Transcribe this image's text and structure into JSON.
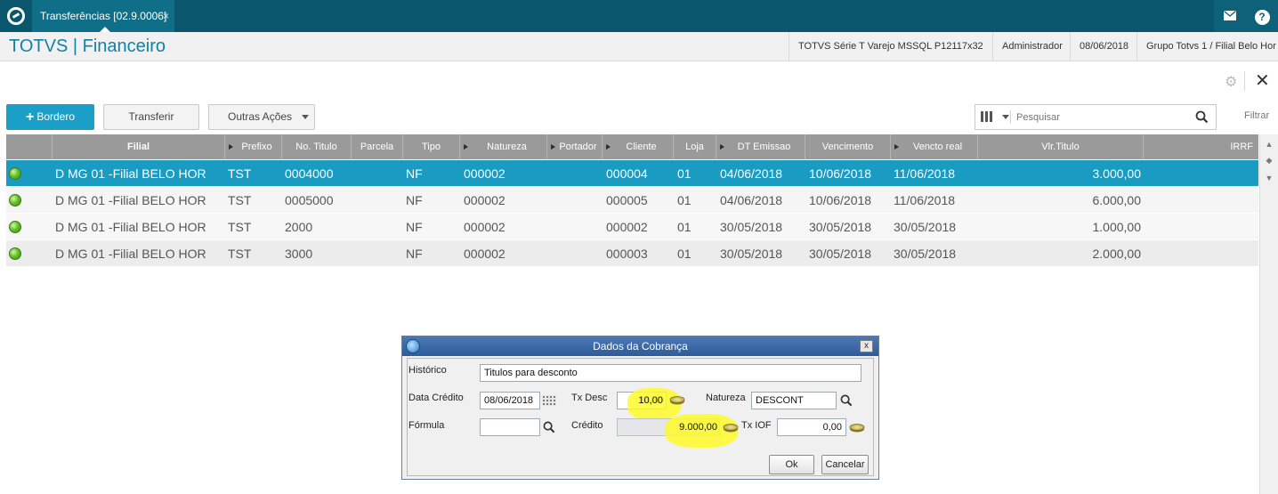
{
  "topbar": {
    "tab_label": "Transferências [02.9.0006]",
    "tab_close": "×",
    "mail_icon": "envelope-icon",
    "help_label": "?"
  },
  "header": {
    "app_title": "TOTVS | Financeiro",
    "environment": "TOTVS Série T Varejo MSSQL P12117x32",
    "user": "Administrador",
    "date": "08/06/2018",
    "branch": "Grupo Totvs 1 / Filial Belo Hor"
  },
  "toolbar": {
    "bordero_label": "Bordero",
    "transferir_label": "Transferir",
    "outras_label": "Outras Ações",
    "search_placeholder": "Pesquisar",
    "filtrar_label": "Filtrar",
    "close_label": "✕"
  },
  "grid": {
    "columns": [
      "",
      "Filial",
      "Prefixo",
      "No. Titulo",
      "Parcela",
      "Tipo",
      "Natureza",
      "Portador",
      "Cliente",
      "Loja",
      "DT Emissao",
      "Vencimento",
      "Vencto real",
      "Vlr.Titulo",
      "IRRF"
    ],
    "rows": [
      {
        "filial": "D MG 01 -Filial BELO HOR",
        "prefixo": "TST",
        "numero": "0004000",
        "parcela": "",
        "tipo": "NF",
        "natureza": "000002",
        "portador": "",
        "cliente": "000004",
        "loja": "01",
        "emissao": "04/06/2018",
        "vencimento": "10/06/2018",
        "vencto_real": "11/06/2018",
        "valor": "3.000,00",
        "irrf": ""
      },
      {
        "filial": "D MG 01 -Filial BELO HOR",
        "prefixo": "TST",
        "numero": "0005000",
        "parcela": "",
        "tipo": "NF",
        "natureza": "000002",
        "portador": "",
        "cliente": "000005",
        "loja": "01",
        "emissao": "04/06/2018",
        "vencimento": "10/06/2018",
        "vencto_real": "11/06/2018",
        "valor": "6.000,00",
        "irrf": ""
      },
      {
        "filial": "D MG 01 -Filial BELO HOR",
        "prefixo": "TST",
        "numero": "2000",
        "parcela": "",
        "tipo": "NF",
        "natureza": "000002",
        "portador": "",
        "cliente": "000002",
        "loja": "01",
        "emissao": "30/05/2018",
        "vencimento": "30/05/2018",
        "vencto_real": "30/05/2018",
        "valor": "1.000,00",
        "irrf": ""
      },
      {
        "filial": "D MG 01 -Filial BELO HOR",
        "prefixo": "TST",
        "numero": "3000",
        "parcela": "",
        "tipo": "NF",
        "natureza": "000002",
        "portador": "",
        "cliente": "000003",
        "loja": "01",
        "emissao": "30/05/2018",
        "vencimento": "30/05/2018",
        "vencto_real": "30/05/2018",
        "valor": "2.000,00",
        "irrf": ""
      }
    ]
  },
  "dialog": {
    "title": "Dados da Cobrança",
    "close_label": "x",
    "historico_label": "Histórico",
    "historico_value": "Titulos para desconto",
    "data_credito_label": "Data Crédito",
    "data_credito_value": "08/06/2018",
    "tx_desc_label": "Tx Desc",
    "tx_desc_value": "10,00",
    "natureza_label": "Natureza",
    "natureza_value": "DESCONT",
    "formula_label": "Fórmula",
    "formula_value": "",
    "credito_label": "Crédito",
    "credito_value": "9.000,00",
    "tx_iof_label": "Tx IOF",
    "tx_iof_value": "0,00",
    "ok_label": "Ok",
    "cancelar_label": "Cancelar"
  },
  "colors": {
    "topbar": "#0a566c",
    "accent": "#1a9fc9",
    "selected_row": "#1a9bc2",
    "grid_header": "#9a9a9a",
    "highlight": "#fffa28"
  }
}
